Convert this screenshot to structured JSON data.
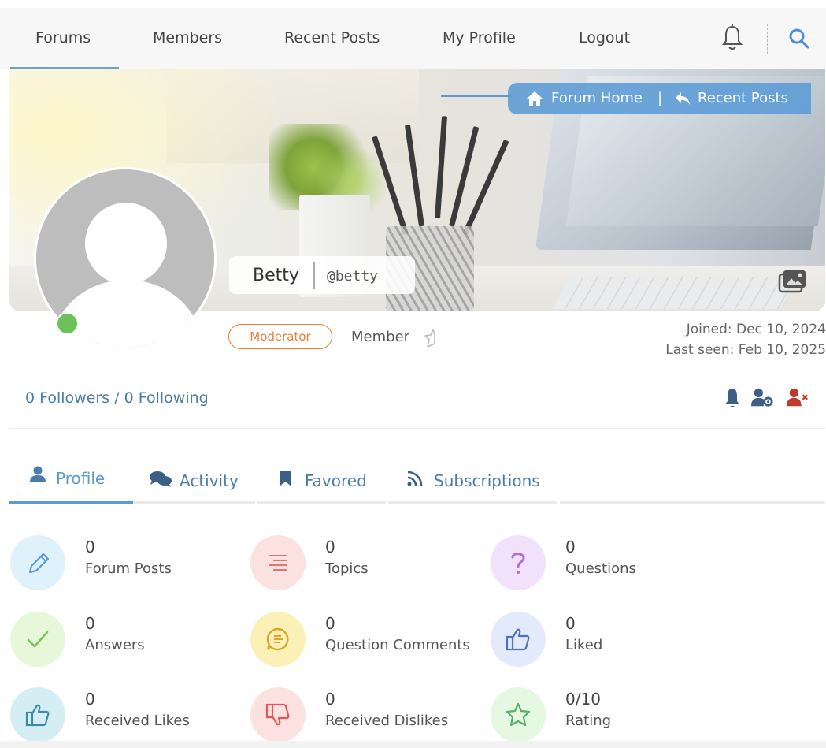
{
  "nav": {
    "items": [
      "Forums",
      "Members",
      "Recent Posts",
      "My Profile",
      "Logout"
    ],
    "bell_icon": "bell-icon",
    "search_icon": "search-icon"
  },
  "breadcrumb": {
    "home": "Forum Home",
    "separator": "|",
    "recent": "Recent Posts"
  },
  "profile": {
    "display_name": "Betty",
    "username": "@betty",
    "online": true,
    "role_badge": "Moderator",
    "rank": "Member",
    "joined": "Joined: Dec 10, 2024",
    "last_seen": "Last seen: Feb 10, 2025"
  },
  "follow": {
    "text": "0 Followers / 0 Following",
    "actions": [
      "bell-icon",
      "user-settings-icon",
      "user-block-icon"
    ]
  },
  "tabs": [
    "Profile",
    "Activity",
    "Favored",
    "Subscriptions"
  ],
  "stats": [
    {
      "value": "0",
      "label": "Forum Posts",
      "icon": "pencil-icon",
      "bg": "#dff1fb",
      "fg": "#5b9bd5"
    },
    {
      "value": "0",
      "label": "Topics",
      "icon": "lines-icon",
      "bg": "#fbe1e0",
      "fg": "#e57373"
    },
    {
      "value": "0",
      "label": "Questions",
      "icon": "question-icon",
      "bg": "#f1e1fb",
      "fg": "#b36fd6"
    },
    {
      "value": "0",
      "label": "Answers",
      "icon": "check-icon",
      "bg": "#e6f8d9",
      "fg": "#7cc25a"
    },
    {
      "value": "0",
      "label": "Question Comments",
      "icon": "comment-icon",
      "bg": "#fbf0b5",
      "fg": "#d7a72a"
    },
    {
      "value": "0",
      "label": "Liked",
      "icon": "thumbs-up-icon",
      "bg": "#e3eafb",
      "fg": "#4e6fc4"
    },
    {
      "value": "0",
      "label": "Received Likes",
      "icon": "thumbs-up-icon",
      "bg": "#d5eef4",
      "fg": "#3d8aa5"
    },
    {
      "value": "0",
      "label": "Received Dislikes",
      "icon": "thumbs-down-icon",
      "bg": "#fbe1e0",
      "fg": "#e25a55"
    },
    {
      "value": "0/10",
      "label": "Rating",
      "icon": "star-icon",
      "bg": "#e4f8e2",
      "fg": "#5ab067"
    }
  ],
  "colors": {
    "accent": "#5b9bd5",
    "moderator": "#e8803a",
    "online": "#6ac259",
    "danger": "#c0392b"
  }
}
